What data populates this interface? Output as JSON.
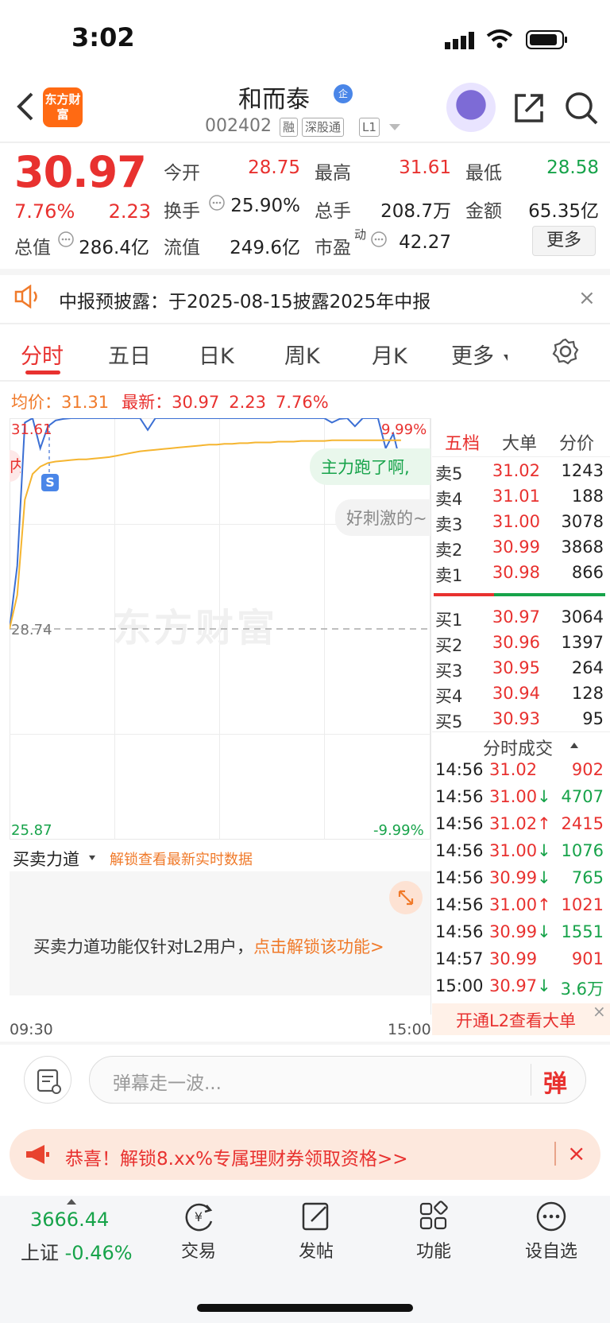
{
  "status_bar": {
    "time": "3:02"
  },
  "header": {
    "app_logo": "东方财富",
    "stock_name": "和而泰",
    "badge": "企",
    "code": "002402",
    "tags": [
      "融",
      "深股通",
      "L1"
    ]
  },
  "quote": {
    "price": "30.97",
    "change_pct": "7.76%",
    "change_amt": "2.23",
    "stats": [
      {
        "label": "今开",
        "value": "28.75",
        "color": "red"
      },
      {
        "label": "最高",
        "value": "31.61",
        "color": "red"
      },
      {
        "label": "最低",
        "value": "28.58",
        "color": "green"
      },
      {
        "label": "换手",
        "value": "25.90%",
        "color": "dark"
      },
      {
        "label": "总手",
        "value": "208.7万",
        "color": "dark"
      },
      {
        "label": "金额",
        "value": "65.35亿",
        "color": "dark"
      },
      {
        "label": "总值",
        "value": "286.4亿",
        "color": "dark"
      },
      {
        "label": "流值",
        "value": "249.6亿",
        "color": "dark"
      },
      {
        "label": "市盈",
        "value": "42.27",
        "color": "dark"
      }
    ],
    "pe_sup": "动",
    "more_label": "更多"
  },
  "notice": {
    "text": "中报预披露：于2025-08-15披露2025年中报"
  },
  "tabs": [
    "分时",
    "五日",
    "日K",
    "周K",
    "月K",
    "更多"
  ],
  "chart_header": {
    "avg_label": "均价：",
    "avg_value": "31.31",
    "latest_label": "最新：",
    "latest_value": "30.97",
    "latest_change": "2.23",
    "latest_pct": "7.76%"
  },
  "chart_labels": {
    "high": "31.61",
    "mid": "28.74",
    "low": "25.87",
    "pct_high": "9.99%",
    "pct_low": "-9.99%",
    "time_start": "09:30",
    "time_end": "15:00",
    "marker": "S",
    "watermark": "东方财富",
    "comment1": "主力跑了啊,",
    "comment2": "好刺激的~",
    "left_edge_char": "内"
  },
  "chart_data": {
    "type": "line",
    "title": "",
    "xlabel": "",
    "ylabel": "",
    "x_range": [
      "09:30",
      "15:00"
    ],
    "ylim": [
      25.87,
      31.61
    ],
    "reference": 28.74,
    "series": [
      {
        "name": "",
        "color": "#3b6fd4",
        "values": [
          28.74,
          29.6,
          31.55,
          31.61,
          31.2,
          31.5,
          31.58,
          31.6,
          31.61,
          31.61,
          31.61,
          31.61,
          31.61,
          31.61,
          31.61,
          31.61,
          31.61,
          31.61,
          31.45,
          31.61,
          31.61,
          31.61,
          31.61,
          31.61,
          31.61,
          31.61,
          31.61,
          31.61,
          31.61,
          31.61,
          31.61,
          31.61,
          31.61,
          31.61,
          31.61,
          31.61,
          31.61,
          31.61,
          31.61,
          31.61,
          31.61,
          31.61,
          31.55,
          31.6,
          31.61,
          31.5,
          31.61,
          31.61,
          31.61,
          31.2,
          31.4,
          30.97
        ]
      },
      {
        "name": "",
        "color": "#f5b530",
        "values": [
          28.74,
          29.2,
          30.5,
          30.85,
          30.95,
          31.0,
          31.02,
          31.03,
          31.04,
          31.05,
          31.05,
          31.06,
          31.07,
          31.08,
          31.1,
          31.12,
          31.14,
          31.16,
          31.17,
          31.18,
          31.19,
          31.2,
          31.21,
          31.22,
          31.23,
          31.24,
          31.25,
          31.25,
          31.26,
          31.26,
          31.27,
          31.27,
          31.28,
          31.28,
          31.28,
          31.29,
          31.29,
          31.29,
          31.3,
          31.3,
          31.3,
          31.3,
          31.31,
          31.31,
          31.31,
          31.31,
          31.31,
          31.31,
          31.31,
          31.31,
          31.31,
          31.31
        ]
      }
    ]
  },
  "right_panel": {
    "tabs": [
      "五档",
      "大单",
      "分价"
    ],
    "asks": [
      {
        "label": "卖5",
        "price": "31.02",
        "vol": "1243"
      },
      {
        "label": "卖4",
        "price": "31.01",
        "vol": "188"
      },
      {
        "label": "卖3",
        "price": "31.00",
        "vol": "3078"
      },
      {
        "label": "卖2",
        "price": "30.99",
        "vol": "3868"
      },
      {
        "label": "卖1",
        "price": "30.98",
        "vol": "866"
      }
    ],
    "bids": [
      {
        "label": "买1",
        "price": "30.97",
        "vol": "3064"
      },
      {
        "label": "买2",
        "price": "30.96",
        "vol": "1397"
      },
      {
        "label": "买3",
        "price": "30.95",
        "vol": "264"
      },
      {
        "label": "买4",
        "price": "30.94",
        "vol": "128"
      },
      {
        "label": "买5",
        "price": "30.93",
        "vol": "95"
      }
    ],
    "trades_title": "分时成交",
    "trades": [
      {
        "time": "14:56",
        "price": "31.02",
        "arrow": "",
        "vol": "902",
        "price_color": "red",
        "vol_color": "red"
      },
      {
        "time": "14:56",
        "price": "31.00",
        "arrow": "↓",
        "vol": "4707",
        "price_color": "red",
        "vol_color": "green"
      },
      {
        "time": "14:56",
        "price": "31.02",
        "arrow": "↑",
        "vol": "2415",
        "price_color": "red",
        "vol_color": "red"
      },
      {
        "time": "14:56",
        "price": "31.00",
        "arrow": "↓",
        "vol": "1076",
        "price_color": "red",
        "vol_color": "green"
      },
      {
        "time": "14:56",
        "price": "30.99",
        "arrow": "↓",
        "vol": "765",
        "price_color": "red",
        "vol_color": "green"
      },
      {
        "time": "14:56",
        "price": "31.00",
        "arrow": "↑",
        "vol": "1021",
        "price_color": "red",
        "vol_color": "red"
      },
      {
        "time": "14:56",
        "price": "30.99",
        "arrow": "↓",
        "vol": "1551",
        "price_color": "red",
        "vol_color": "green"
      },
      {
        "time": "14:57",
        "price": "30.99",
        "arrow": "",
        "vol": "901",
        "price_color": "red",
        "vol_color": "red"
      },
      {
        "time": "15:00",
        "price": "30.97",
        "arrow": "↓",
        "vol": "3.6万",
        "price_color": "red",
        "vol_color": "green"
      }
    ],
    "l2_banner": "开通L2查看大单"
  },
  "strength": {
    "title": "买卖力道",
    "unlock_link": "解锁查看最新实时数据",
    "notice_prefix": "买卖力道功能仅针对L2用户，",
    "notice_link": "点击解锁该功能>"
  },
  "danmu": {
    "placeholder": "弹幕走一波...",
    "send_label": "弹"
  },
  "promo": {
    "text": "恭喜！解锁8.xx%专属理财券领取资格>>"
  },
  "bottom_nav": {
    "index_value": "3666.44",
    "index_name": "上证",
    "index_change": "-0.46%",
    "items": [
      "交易",
      "发帖",
      "功能",
      "设自选"
    ]
  },
  "colors": {
    "up": "#e8312f",
    "down": "#17a34a",
    "accent": "#f07a2a",
    "price_line": "#3b6fd4",
    "avg_line": "#f5b530"
  }
}
